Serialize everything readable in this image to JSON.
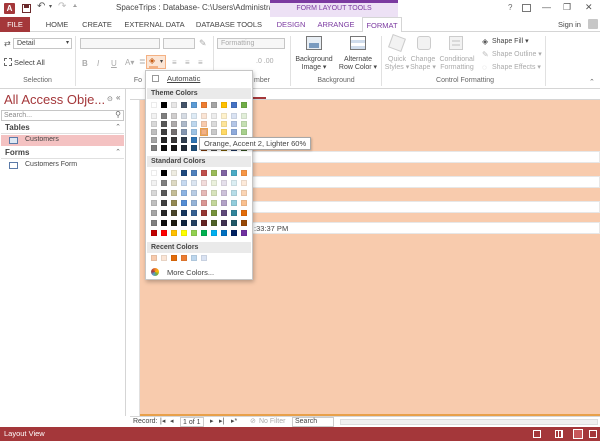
{
  "title_bar": {
    "title": "SpaceTrips : Database- C:\\Users\\Administra...",
    "context_label": "FORM LAYOUT TOOLS",
    "help": "?",
    "controls": [
      "—",
      "❐",
      "✕"
    ]
  },
  "tabs": [
    {
      "label": "FILE"
    },
    {
      "label": "HOME"
    },
    {
      "label": "CREATE"
    },
    {
      "label": "EXTERNAL DATA"
    },
    {
      "label": "DATABASE TOOLS"
    },
    {
      "label": "DESIGN"
    },
    {
      "label": "ARRANGE"
    },
    {
      "label": "FORMAT"
    }
  ],
  "sign_in": "Sign in",
  "ribbon": {
    "selection_dropdown": "Detail",
    "select_all": "Select All",
    "selection_label": "Selection",
    "formatting_dropdown": "Formatting",
    "font_label_partial": "Fo",
    "number_label_partial": "mber",
    "background_image": [
      "Background",
      "Image ▾"
    ],
    "alternate_row_color": [
      "Alternate",
      "Row Color ▾"
    ],
    "background_label": "Background",
    "quick_styles": [
      "Quick",
      "Styles ▾"
    ],
    "change_shape": [
      "Change",
      "Shape ▾"
    ],
    "conditional_formatting": [
      "Conditional",
      "Formatting"
    ],
    "shape_fill": "Shape Fill ▾",
    "shape_outline": "Shape Outline ▾",
    "shape_effects": "Shape Effects ▾",
    "control_formatting_label": "Control Formatting",
    "font_buttons": [
      "B",
      "I",
      "U"
    ]
  },
  "nav_pane": {
    "title": "All Access Obje...",
    "search_placeholder": "Search...",
    "sections": [
      {
        "name": "Tables",
        "items": [
          "Customers"
        ]
      },
      {
        "name": "Forms",
        "items": [
          "Customers Form"
        ]
      }
    ]
  },
  "color_picker": {
    "automatic": "Automatic",
    "theme_colors": "Theme Colors",
    "standard_colors": "Standard Colors",
    "recent_colors": "Recent Colors",
    "more_colors": "More Colors...",
    "tooltip": "Orange, Accent 2, Lighter 60%",
    "theme_top": [
      "#ffffff",
      "#000000",
      "#e7e6e6",
      "#44546a",
      "#5b9bd5",
      "#ed7d31",
      "#a5a5a5",
      "#ffc000",
      "#4472c4",
      "#70ad47"
    ],
    "theme_shades": [
      [
        "#f2f2f2",
        "#7f7f7f",
        "#d0cece",
        "#d6dce4",
        "#deebf6",
        "#fbe5d5",
        "#ededed",
        "#fff2cc",
        "#dae3f3",
        "#e2efd9"
      ],
      [
        "#d8d8d8",
        "#595959",
        "#aeabab",
        "#adb9ca",
        "#bdd7ee",
        "#f8cbad",
        "#dbdbdb",
        "#fee599",
        "#b4c6e7",
        "#c5e0b3"
      ],
      [
        "#bfbfbf",
        "#3f3f3f",
        "#757070",
        "#8496b0",
        "#9cc3e5",
        "#f4b183",
        "#c9c9c9",
        "#ffd965",
        "#8eaadb",
        "#a8d08d"
      ],
      [
        "#a5a5a5",
        "#262626",
        "#3a3838",
        "#323f4f",
        "#2e75b5",
        "#c55a11",
        "#7b7b7b",
        "#bf9000",
        "#2f5496",
        "#538135"
      ],
      [
        "#7f7f7f",
        "#0c0c0c",
        "#171616",
        "#222a35",
        "#1e4e79",
        "#833c0b",
        "#525252",
        "#7f6000",
        "#1f3864",
        "#375623"
      ]
    ],
    "standard": [
      [
        "#ffffff",
        "#000000",
        "#eeece1",
        "#1f497d",
        "#4f81bd",
        "#c0504d",
        "#9bbb59",
        "#8064a2",
        "#4bacc6",
        "#f79646"
      ],
      [
        "#f2f2f2",
        "#7f7f7f",
        "#ddd9c3",
        "#c6d9f0",
        "#dbe5f1",
        "#f2dcdb",
        "#ebf1dd",
        "#e5e0ec",
        "#dbeef3",
        "#fdeada"
      ],
      [
        "#d8d8d8",
        "#595959",
        "#c4bd97",
        "#8db3e2",
        "#b8cce4",
        "#e5b9b7",
        "#d7e3bc",
        "#ccc1d9",
        "#b7dde8",
        "#fbd5b5"
      ],
      [
        "#bfbfbf",
        "#3f3f3f",
        "#938953",
        "#548dd4",
        "#95b3d7",
        "#d99694",
        "#c3d69b",
        "#b2a2c7",
        "#92cddc",
        "#fac08f"
      ],
      [
        "#a5a5a5",
        "#262626",
        "#494429",
        "#17365d",
        "#366092",
        "#953734",
        "#76923c",
        "#5f497a",
        "#31859b",
        "#e36c09"
      ],
      [
        "#7f7f7f",
        "#0c0c0c",
        "#1d1b10",
        "#0f243e",
        "#244061",
        "#632423",
        "#4f6128",
        "#3f3151",
        "#205867",
        "#974806"
      ],
      [
        "#c00000",
        "#ff0000",
        "#ffc000",
        "#ffff00",
        "#92d050",
        "#00b050",
        "#00b0f0",
        "#0070c0",
        "#002060",
        "#7030a0"
      ]
    ],
    "recent": [
      "#f8cbad",
      "#fbe5d5",
      "#e36c09",
      "#ed7d31",
      "#bdd7ee",
      "#dae3f3"
    ]
  },
  "form": {
    "timestamp_partial": ":33:37 PM"
  },
  "record_nav": {
    "label": "Record:",
    "first": "|◂",
    "prev": "◂",
    "position": "1 of 1",
    "next": "▸",
    "last": "▸|",
    "new": "▸*",
    "filter": "No Filter",
    "search": "Search"
  },
  "status": {
    "left": "Layout View"
  },
  "colors": {
    "accent": "#a4373a",
    "band": "#f8cbad",
    "context_tab": "#7b3aa0"
  }
}
